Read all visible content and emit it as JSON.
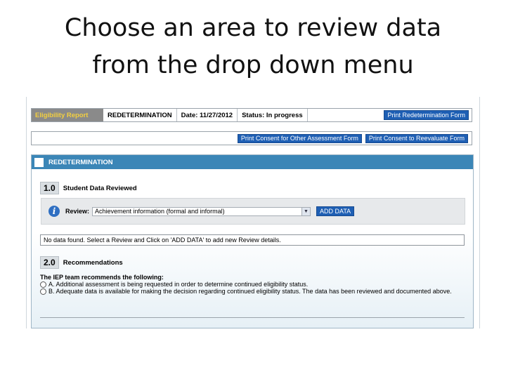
{
  "slide": {
    "title_line1": "Choose an area to review data",
    "title_line2": "from the drop down menu"
  },
  "header": {
    "eligibility_report": "Eligibility Report",
    "redetermination": "REDETERMINATION",
    "date": "Date: 11/27/2012",
    "status": "Status: In progress",
    "print_redetermination_form": "Print Redetermination Form"
  },
  "toolbar": {
    "print_consent_other": "Print Consent for Other Assessment Form",
    "print_consent_reevaluate": "Print Consent to Reevaluate Form"
  },
  "section": {
    "title": "REDETERMINATION",
    "student_data": {
      "number": "1.0",
      "label": "Student Data Reviewed",
      "review_label": "Review:",
      "review_selected": "Achievement information (formal and informal)",
      "add_data_label": "ADD DATA",
      "no_data_message": "No data found. Select a Review and Click on 'ADD DATA' to add new Review details."
    },
    "recommendations": {
      "number": "2.0",
      "label": "Recommendations",
      "heading": "The IEP team recommends the following:",
      "option_a": "A. Additional assessment is being requested in order to determine continued eligibility status.",
      "option_b": "B. Adequate data is available for making the decision regarding continued eligibility status. The data has been reviewed and documented above."
    }
  },
  "colors": {
    "section_bar": "#3b86b7",
    "button": "#1e5fb4",
    "eligibility_tab_bg": "#8a8a8a",
    "eligibility_tab_text": "#f4d03f"
  },
  "icons": {
    "info": "info-icon",
    "dropdown": "chevron-down-icon"
  }
}
